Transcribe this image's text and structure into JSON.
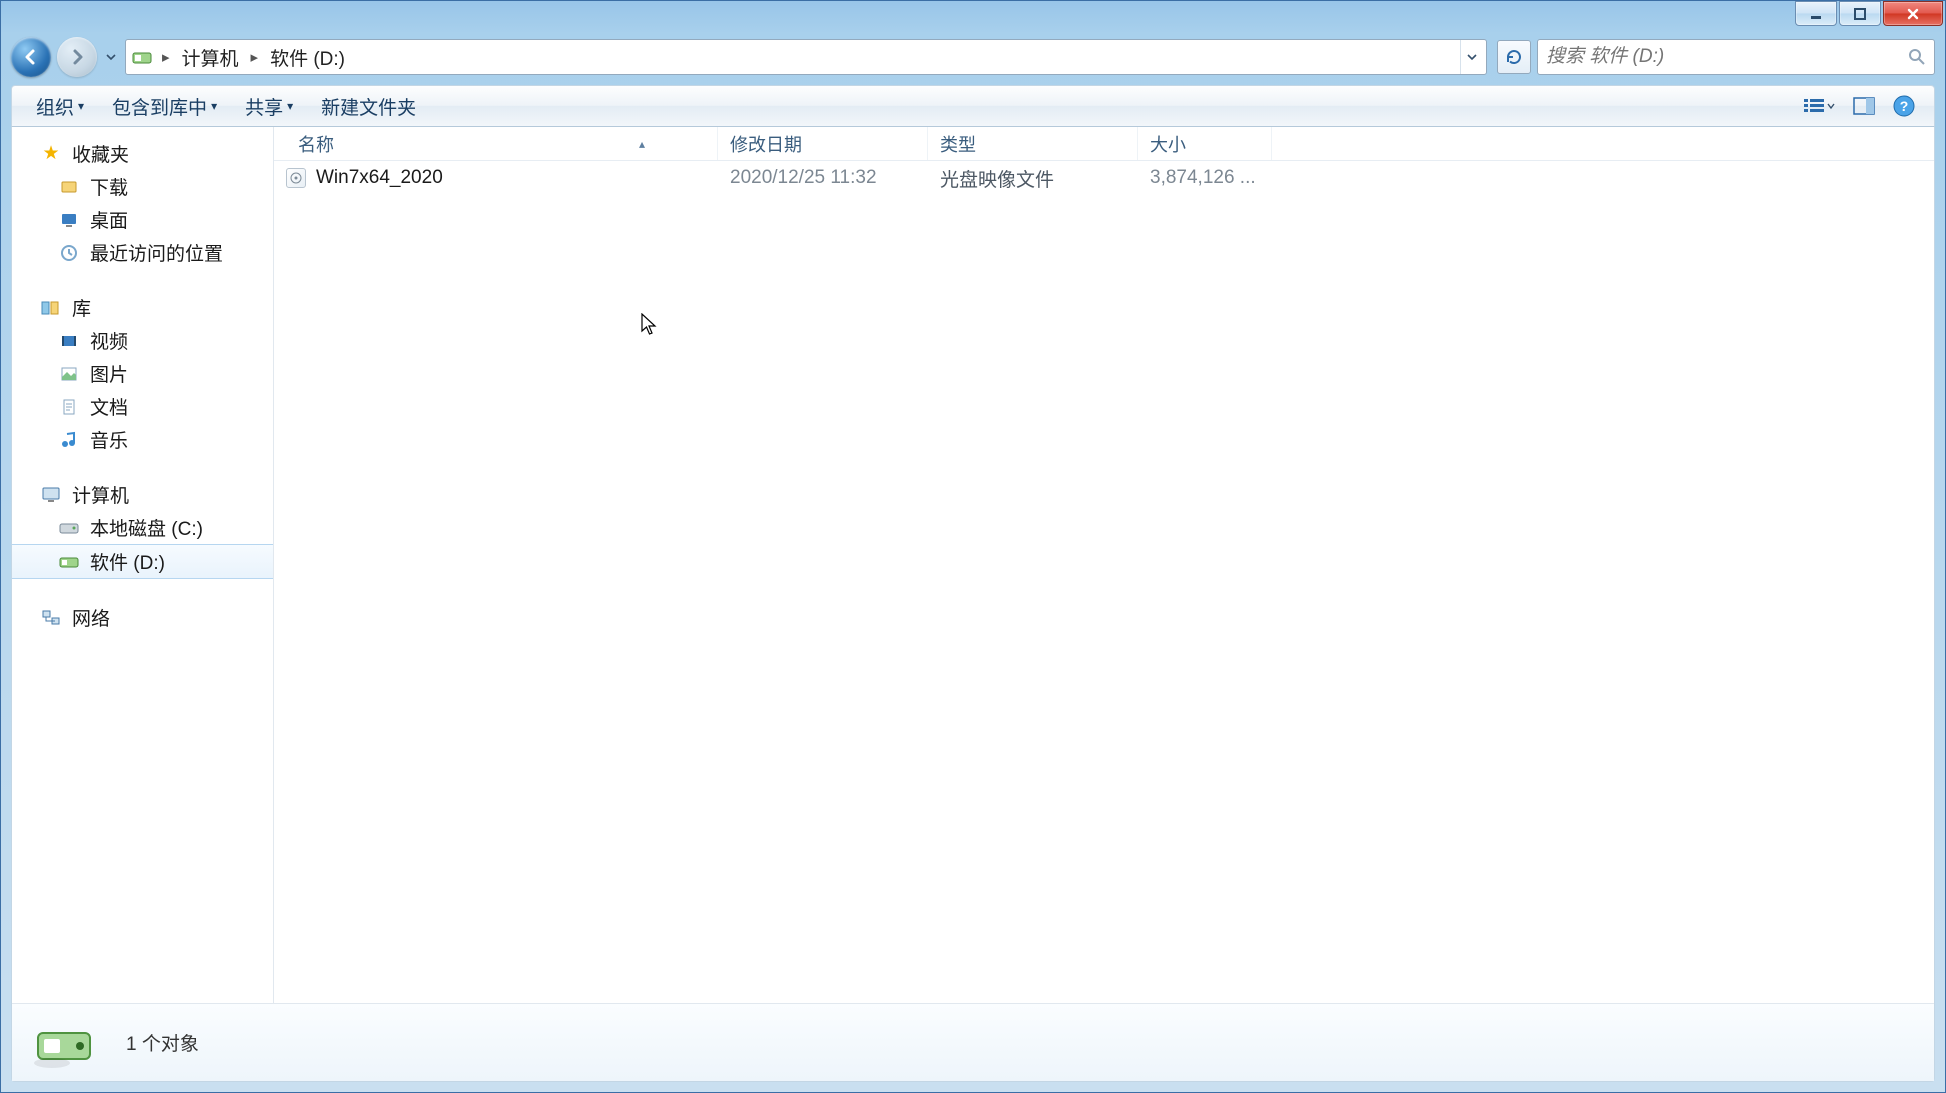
{
  "window": {
    "controls": {
      "min": "minimize",
      "max": "maximize",
      "close": "close"
    }
  },
  "address": {
    "segments": [
      "计算机",
      "软件 (D:)"
    ]
  },
  "search": {
    "placeholder": "搜索 软件 (D:)"
  },
  "toolbar": {
    "organize": "组织",
    "include": "包含到库中",
    "share": "共享",
    "newfolder": "新建文件夹"
  },
  "sidebar": {
    "favorites": {
      "label": "收藏夹",
      "items": [
        {
          "key": "downloads",
          "label": "下载"
        },
        {
          "key": "desktop",
          "label": "桌面"
        },
        {
          "key": "recent",
          "label": "最近访问的位置"
        }
      ]
    },
    "libraries": {
      "label": "库",
      "items": [
        {
          "key": "videos",
          "label": "视频"
        },
        {
          "key": "pictures",
          "label": "图片"
        },
        {
          "key": "documents",
          "label": "文档"
        },
        {
          "key": "music",
          "label": "音乐"
        }
      ]
    },
    "computer": {
      "label": "计算机",
      "items": [
        {
          "key": "drive-c",
          "label": "本地磁盘 (C:)"
        },
        {
          "key": "drive-d",
          "label": "软件 (D:)",
          "selected": true
        }
      ]
    },
    "network": {
      "label": "网络"
    }
  },
  "columns": {
    "name": "名称",
    "date": "修改日期",
    "type": "类型",
    "size": "大小"
  },
  "files": [
    {
      "name": "Win7x64_2020",
      "date": "2020/12/25 11:32",
      "type": "光盘映像文件",
      "size": "3,874,126 ..."
    }
  ],
  "status": {
    "text": "1 个对象"
  }
}
